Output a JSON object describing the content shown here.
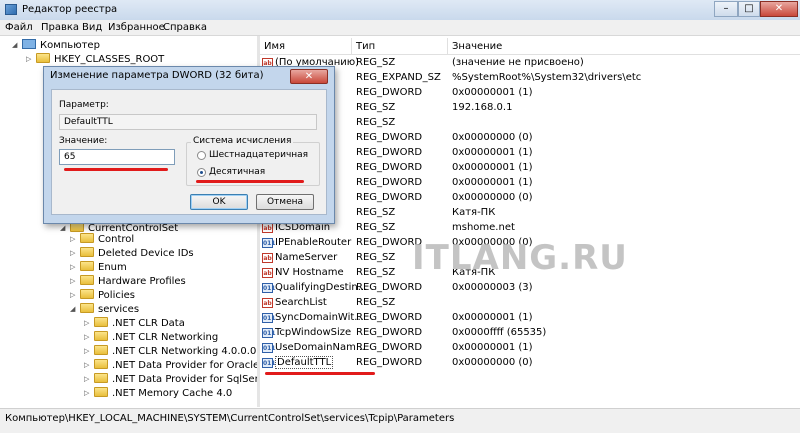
{
  "window": {
    "title": "Редактор реестра",
    "minimize": "–",
    "maximize": "□",
    "close": "✕"
  },
  "menu": [
    "Файл",
    "Правка",
    "Вид",
    "Избранное",
    "Справка"
  ],
  "tree": {
    "root": "Компьютер",
    "hkcr": "HKEY_CLASSES_ROOT",
    "ccs": "CurrentControlSet",
    "items": [
      "Control",
      "Deleted Device IDs",
      "Enum",
      "Hardware Profiles",
      "Policies",
      "services"
    ],
    "services_children": [
      ".NET CLR Data",
      ".NET CLR Networking",
      ".NET CLR Networking 4.0.0.0",
      ".NET Data Provider for Oracle",
      ".NET Data Provider for SqlServe",
      ".NET Memory Cache 4.0"
    ]
  },
  "columns": {
    "name": "Имя",
    "type": "Тип",
    "value": "Значение"
  },
  "rows": [
    {
      "name": "(По умолчанию)",
      "type": "REG_SZ",
      "data": "(значение не присвоено)",
      "icon": "sz"
    },
    {
      "name": "",
      "type": "REG_EXPAND_SZ",
      "data": "%SystemRoot%\\System32\\drivers\\etc",
      "icon": "sz"
    },
    {
      "name": "ct",
      "type": "REG_DWORD",
      "data": "0x00000001 (1)",
      "icon": "dw"
    },
    {
      "name": "rver",
      "type": "REG_SZ",
      "data": "192.168.0.1",
      "icon": "sz"
    },
    {
      "name": "",
      "type": "REG_SZ",
      "data": "",
      "icon": "sz"
    },
    {
      "name": "ault...",
      "type": "REG_DWORD",
      "data": "0x00000000 (0)",
      "icon": "dw"
    },
    {
      "name": "edi...",
      "type": "REG_DWORD",
      "data": "0x00000001 (1)",
      "icon": "dw"
    },
    {
      "name": "",
      "type": "REG_DWORD",
      "data": "0x00000001 (1)",
      "icon": "dw"
    },
    {
      "name": "",
      "type": "REG_DWORD",
      "data": "0x00000001 (1)",
      "icon": "dw"
    },
    {
      "name": "dca...",
      "type": "REG_DWORD",
      "data": "0x00000000 (0)",
      "icon": "dw"
    },
    {
      "name": "",
      "type": "REG_SZ",
      "data": "Катя-ПК",
      "icon": "sz"
    },
    {
      "name": "ICSDomain",
      "type": "REG_SZ",
      "data": "mshome.net",
      "icon": "sz"
    },
    {
      "name": "IPEnableRouter",
      "type": "REG_DWORD",
      "data": "0x00000000 (0)",
      "icon": "dw"
    },
    {
      "name": "NameServer",
      "type": "REG_SZ",
      "data": "",
      "icon": "sz"
    },
    {
      "name": "NV Hostname",
      "type": "REG_SZ",
      "data": "Катя-ПК",
      "icon": "sz"
    },
    {
      "name": "QualifyingDestin...",
      "type": "REG_DWORD",
      "data": "0x00000003 (3)",
      "icon": "dw"
    },
    {
      "name": "SearchList",
      "type": "REG_SZ",
      "data": "",
      "icon": "sz"
    },
    {
      "name": "SyncDomainWit...",
      "type": "REG_DWORD",
      "data": "0x00000001 (1)",
      "icon": "dw"
    },
    {
      "name": "TcpWindowSize",
      "type": "REG_DWORD",
      "data": "0x0000ffff (65535)",
      "icon": "dw"
    },
    {
      "name": "UseDomainNam...",
      "type": "REG_DWORD",
      "data": "0x00000001 (1)",
      "icon": "dw"
    },
    {
      "name": "DefaultTTL",
      "type": "REG_DWORD",
      "data": "0x00000000 (0)",
      "icon": "dw"
    }
  ],
  "watermark": "ITLANG.RU",
  "status": "Компьютер\\HKEY_LOCAL_MACHINE\\SYSTEM\\CurrentControlSet\\services\\Tcpip\\Parameters",
  "dialog": {
    "title": "Изменение параметра DWORD (32 бита)",
    "param_label": "Параметр:",
    "param_value": "DefaultTTL",
    "value_label": "Значение:",
    "value": "65",
    "base_label": "Система исчисления",
    "hex": "Шестнадцатеричная",
    "dec": "Десятичная",
    "ok": "OK",
    "cancel": "Отмена",
    "close": "✕"
  },
  "colors": {
    "highlight_line": "#e11b1b",
    "dialog_frame": "#c3d6ec"
  }
}
